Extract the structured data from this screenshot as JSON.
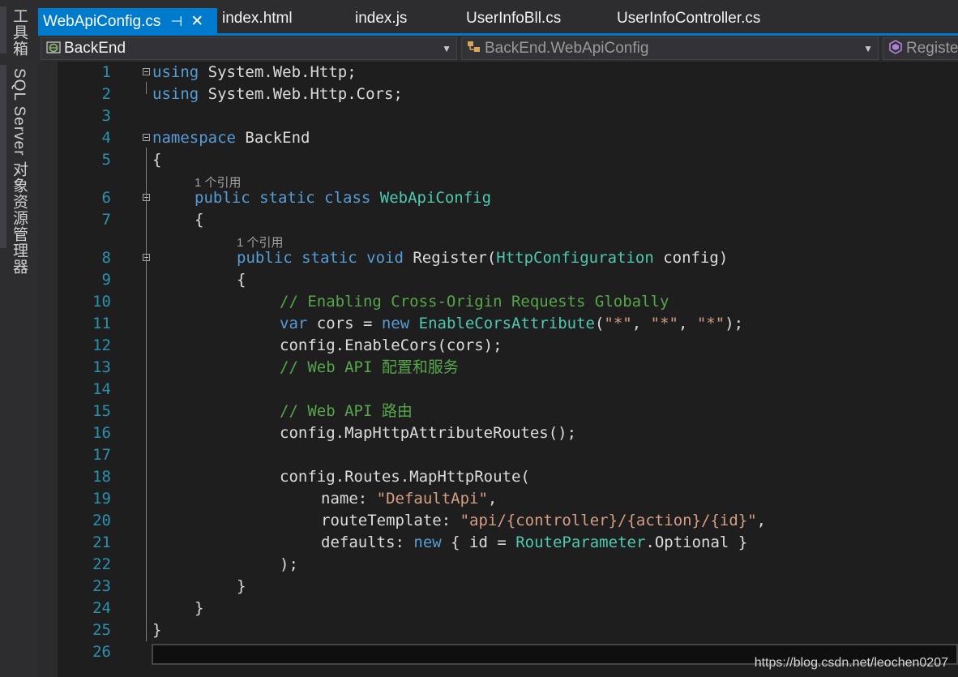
{
  "side_panels": {
    "toolbox_label": "工具箱",
    "sql_explorer_label": "SQL Server 对象资源管理器"
  },
  "tabs": [
    {
      "label": "WebApiConfig.cs",
      "active": true,
      "pin_glyph": "⊣",
      "close_glyph": "✕"
    },
    {
      "label": "index.html",
      "active": false
    },
    {
      "label": "index.js",
      "active": false
    },
    {
      "label": "UserInfoBll.cs",
      "active": false
    },
    {
      "label": "UserInfoController.cs",
      "active": false
    }
  ],
  "navigation": {
    "project": "BackEnd",
    "type": "BackEnd.WebApiConfig",
    "member": "Register"
  },
  "code_lens": [
    {
      "text": "1 个引用"
    },
    {
      "text": "1 个引用"
    }
  ],
  "code": {
    "lines": [
      {
        "n": "1"
      },
      {
        "n": "2"
      },
      {
        "n": "3"
      },
      {
        "n": "4"
      },
      {
        "n": "5"
      },
      {
        "n": "6"
      },
      {
        "n": "7"
      },
      {
        "n": "8"
      },
      {
        "n": "9"
      },
      {
        "n": "10"
      },
      {
        "n": "11"
      },
      {
        "n": "12"
      },
      {
        "n": "13"
      },
      {
        "n": "14"
      },
      {
        "n": "15"
      },
      {
        "n": "16"
      },
      {
        "n": "17"
      },
      {
        "n": "18"
      },
      {
        "n": "19"
      },
      {
        "n": "20"
      },
      {
        "n": "21"
      },
      {
        "n": "22"
      },
      {
        "n": "23"
      },
      {
        "n": "24"
      },
      {
        "n": "25"
      },
      {
        "n": "26"
      }
    ],
    "tokens": {
      "l1": [
        "using",
        " System.Web.Http;"
      ],
      "l2": [
        "using",
        " System.Web.Http.Cors;"
      ],
      "l4": [
        "namespace",
        " BackEnd"
      ],
      "l5": [
        "{"
      ],
      "l6": [
        "public static class",
        " ",
        "WebApiConfig"
      ],
      "l7": [
        "{"
      ],
      "l8": [
        "public static void",
        " Register(",
        "HttpConfiguration",
        " config)"
      ],
      "l9": [
        "{"
      ],
      "l10": [
        "// Enabling Cross-Origin Requests Globally"
      ],
      "l11": [
        "var",
        " cors = ",
        "new",
        " ",
        "EnableCorsAttribute",
        "(",
        "\"*\"",
        ", ",
        "\"*\"",
        ", ",
        "\"*\"",
        ");"
      ],
      "l12": [
        "config.EnableCors(cors);"
      ],
      "l13": [
        "// Web API 配置和服务"
      ],
      "l15": [
        "// Web API 路由"
      ],
      "l16": [
        "config.MapHttpAttributeRoutes();"
      ],
      "l18": [
        "config.Routes.MapHttpRoute("
      ],
      "l19": [
        "name: ",
        "\"DefaultApi\"",
        ","
      ],
      "l20": [
        "routeTemplate: ",
        "\"api/{controller}/{action}/{id}\"",
        ","
      ],
      "l21": [
        "defaults: ",
        "new",
        " { id = ",
        "RouteParameter",
        ".Optional }"
      ],
      "l22": [
        ");"
      ],
      "l23": [
        "}"
      ],
      "l24": [
        "}"
      ],
      "l25": [
        "}"
      ]
    }
  },
  "watermark": "https://blog.csdn.net/leochen0207",
  "colors": {
    "accent": "#007acc",
    "keyword": "#569cd6",
    "type": "#4ec9b0",
    "comment": "#57a64a",
    "string": "#d69d85",
    "line_number": "#2b91af"
  }
}
